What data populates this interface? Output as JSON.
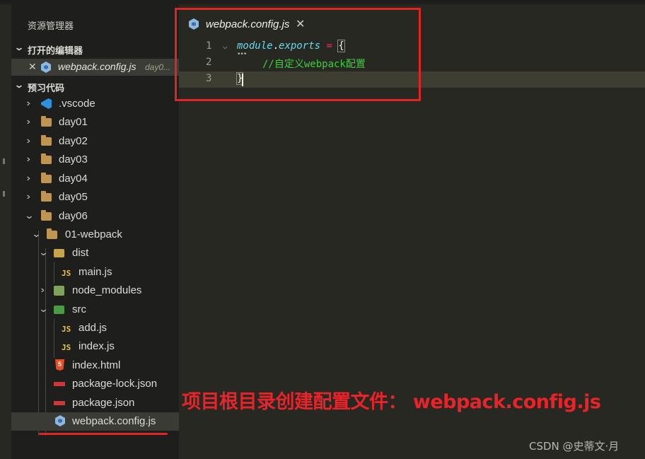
{
  "explorer": {
    "title": "资源管理器",
    "open_editors_section": "打开的编辑器",
    "open_editor": {
      "name": "webpack.config.js",
      "dir": "day0..."
    },
    "project_section": "预习代码",
    "tree": [
      {
        "label": ".vscode",
        "icon": "vscode-folder-icon"
      },
      {
        "label": "day01",
        "icon": "folder-icon"
      },
      {
        "label": "day02",
        "icon": "folder-icon"
      },
      {
        "label": "day03",
        "icon": "folder-icon"
      },
      {
        "label": "day04",
        "icon": "folder-icon"
      },
      {
        "label": "day05",
        "icon": "folder-icon"
      },
      {
        "label": "day06",
        "icon": "folder-open-icon"
      },
      {
        "label": "01-webpack",
        "icon": "folder-open-icon"
      },
      {
        "label": "dist",
        "icon": "dist-folder-icon"
      },
      {
        "label": "main.js",
        "icon": "js-file-icon"
      },
      {
        "label": "node_modules",
        "icon": "node-folder-icon"
      },
      {
        "label": "src",
        "icon": "src-folder-icon"
      },
      {
        "label": "add.js",
        "icon": "js-file-icon"
      },
      {
        "label": "index.js",
        "icon": "js-file-icon"
      },
      {
        "label": "index.html",
        "icon": "html-file-icon"
      },
      {
        "label": "package-lock.json",
        "icon": "npm-file-icon"
      },
      {
        "label": "package.json",
        "icon": "npm-file-icon"
      },
      {
        "label": "webpack.config.js",
        "icon": "webpack-file-icon"
      }
    ]
  },
  "editor": {
    "tab": {
      "name": "webpack.config.js",
      "close": "✕"
    },
    "lines": [
      {
        "number": "1",
        "kw1": "module",
        "dot": ".",
        "kw2": "exports",
        "eq": " = ",
        "brace": "{"
      },
      {
        "number": "2",
        "comment": "//自定义webpack配置"
      },
      {
        "number": "3",
        "brace": "}"
      }
    ]
  },
  "annotation": "项目根目录创建配置文件： webpack.config.js",
  "watermark": "CSDN @史蒂文·月",
  "colors": {
    "accent_red": "#e02424",
    "editor_bg": "#272822",
    "sidebar_bg": "#1e1f1c"
  }
}
